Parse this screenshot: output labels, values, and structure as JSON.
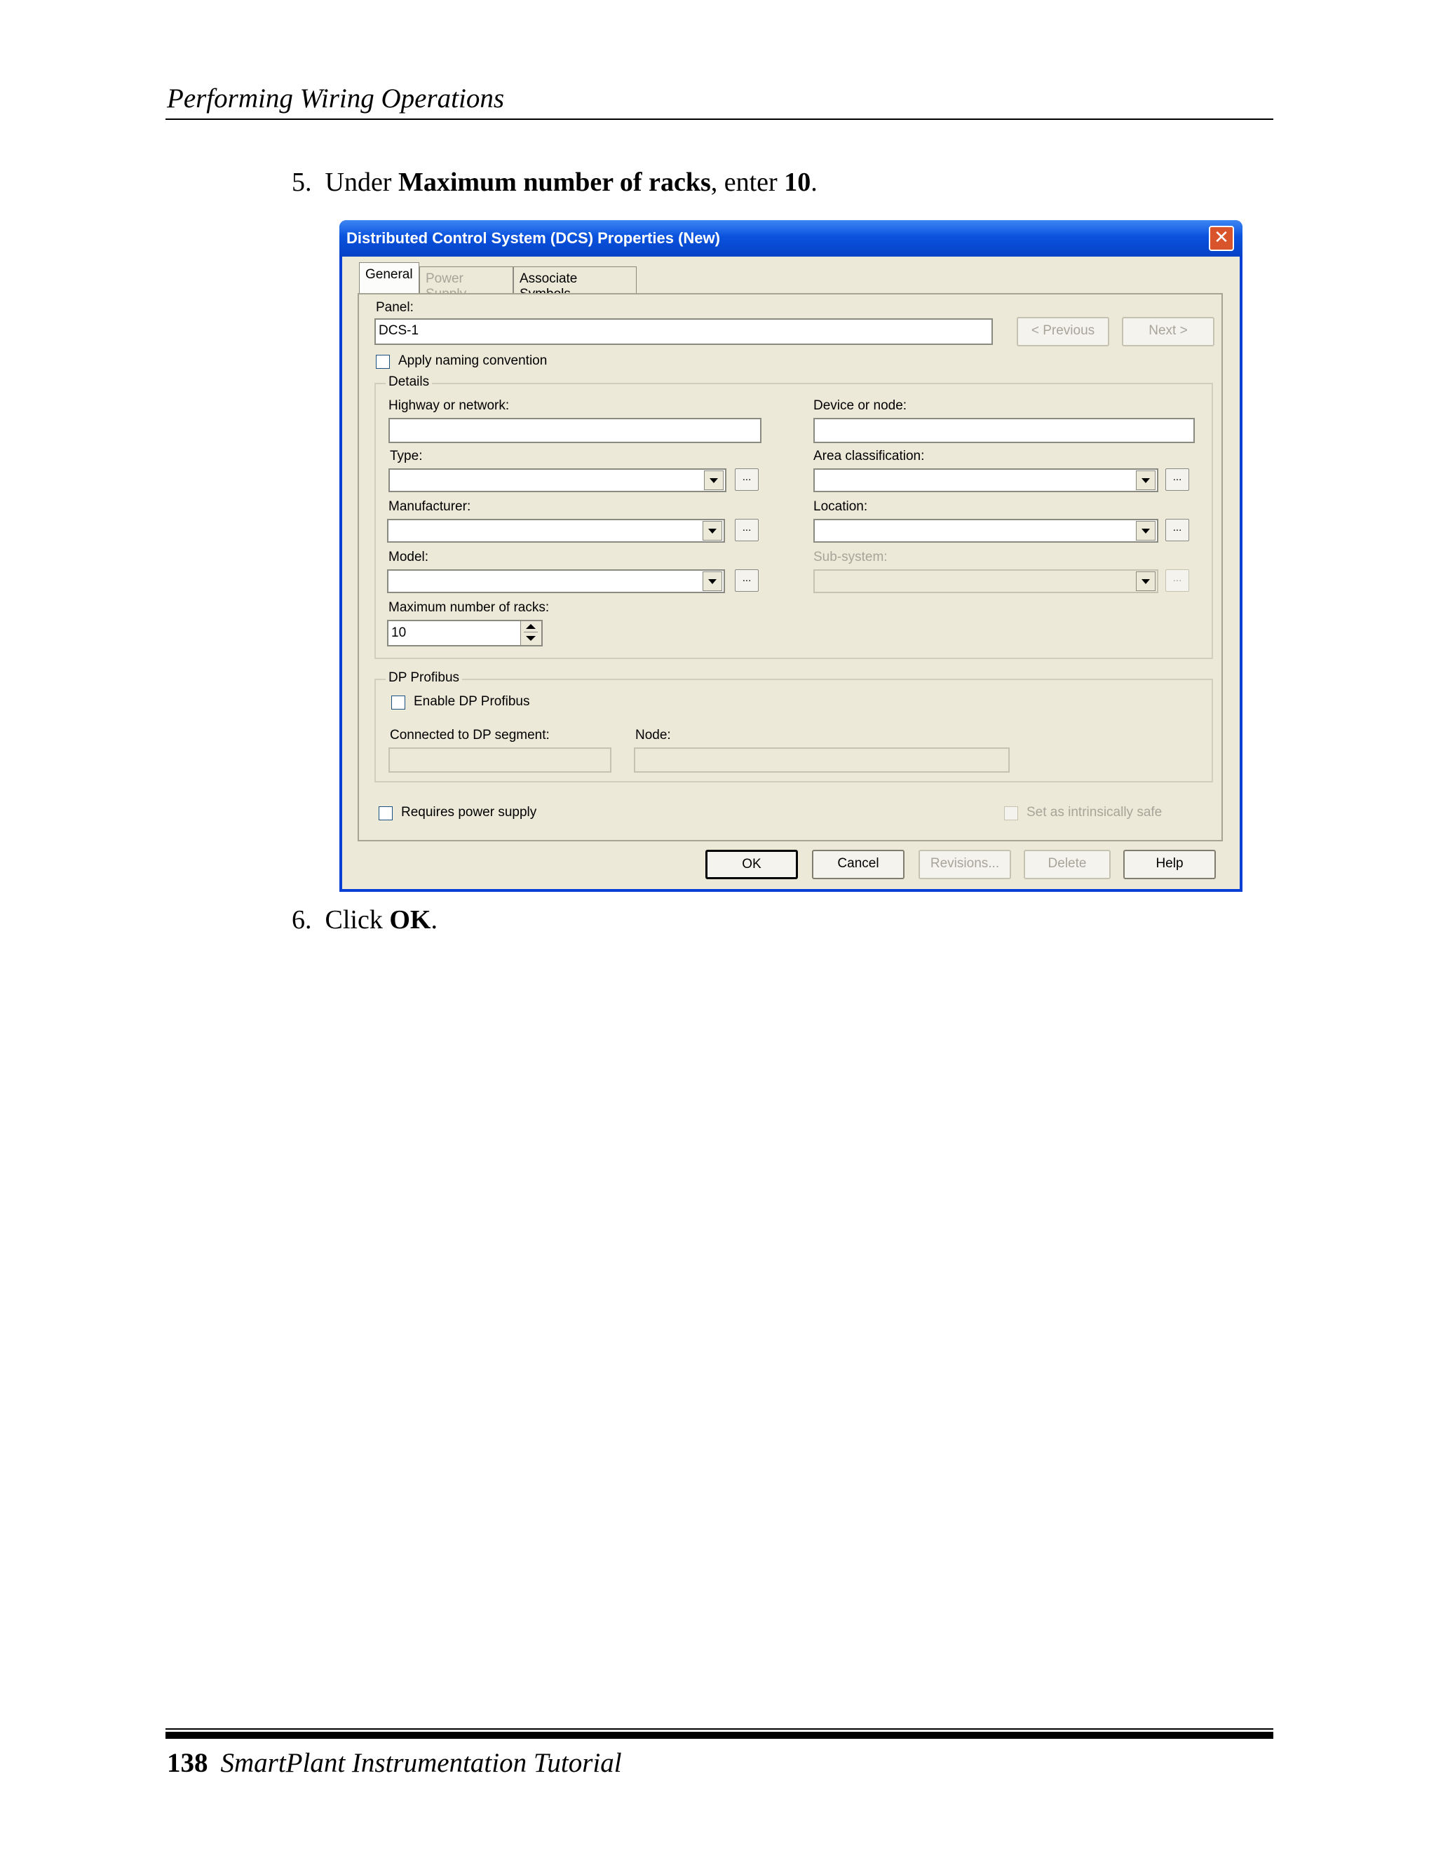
{
  "header": {
    "running_title": "Performing Wiring Operations"
  },
  "steps": [
    {
      "number": "5.",
      "prefix": "Under ",
      "bold1": "Maximum number of racks",
      "middle": ", enter ",
      "bold2": "10",
      "suffix": "."
    },
    {
      "number": "6.",
      "prefix": "Click ",
      "bold1": "OK",
      "suffix": "."
    }
  ],
  "dialog": {
    "title": "Distributed Control System (DCS) Properties (New)",
    "close_icon": "close-icon",
    "tabs": [
      {
        "label": "General",
        "active": true,
        "enabled": true
      },
      {
        "label": "Power Supply",
        "active": false,
        "enabled": false
      },
      {
        "label": "Associate Symbols",
        "active": false,
        "enabled": true
      }
    ],
    "panel": {
      "label": "Panel:",
      "value": "DCS-1"
    },
    "nav": {
      "previous": "< Previous",
      "next": "Next >"
    },
    "apply_naming": {
      "label": "Apply naming convention",
      "checked": false
    },
    "details": {
      "label": "Details",
      "highway": {
        "label": "Highway or network:",
        "value": ""
      },
      "device": {
        "label": "Device or node:",
        "value": ""
      },
      "type": {
        "label": "Type:",
        "value": "",
        "browse": "..."
      },
      "area": {
        "label": "Area classification:",
        "value": "",
        "browse": "..."
      },
      "manufacturer": {
        "label": "Manufacturer:",
        "value": "",
        "browse": "..."
      },
      "location": {
        "label": "Location:",
        "value": "",
        "browse": "..."
      },
      "model": {
        "label": "Model:",
        "value": "",
        "browse": "..."
      },
      "subsystem": {
        "label": "Sub-system:",
        "value": "",
        "browse": "...",
        "enabled": false
      },
      "max_racks": {
        "label": "Maximum number of racks:",
        "value": "10"
      }
    },
    "dp_profibus": {
      "label": "DP Profibus",
      "enable": {
        "label": "Enable DP Profibus",
        "checked": false
      },
      "segment": {
        "label": "Connected to DP segment:",
        "value": ""
      },
      "node": {
        "label": "Node:",
        "value": ""
      }
    },
    "requires_power": {
      "label": "Requires power supply",
      "checked": false
    },
    "intrinsic": {
      "label": "Set as intrinsically safe",
      "checked": false,
      "enabled": false
    },
    "buttons": {
      "ok": "OK",
      "cancel": "Cancel",
      "revisions": "Revisions...",
      "delete": "Delete",
      "help": "Help"
    },
    "colors": {
      "title_bar": "#0a52dd",
      "client": "#ece9d8",
      "close": "#d9532b"
    }
  },
  "footer": {
    "page_number": "138",
    "book_title": "SmartPlant Instrumentation Tutorial"
  }
}
